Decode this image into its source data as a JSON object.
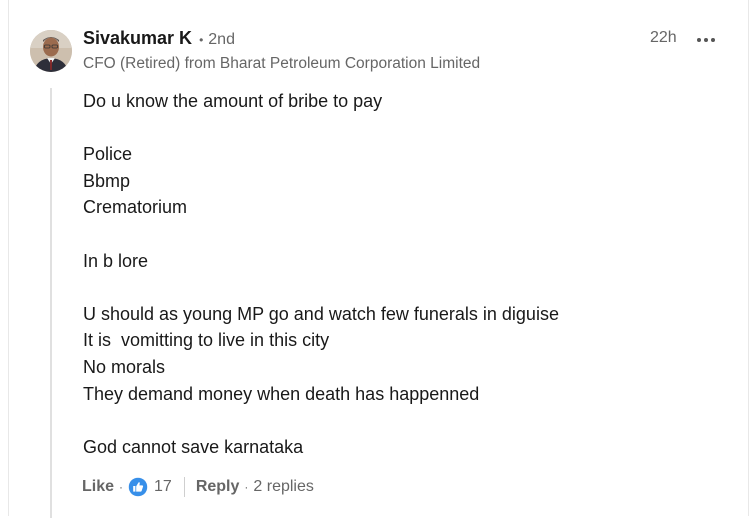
{
  "author": {
    "name": "Sivakumar K",
    "degree": "2nd",
    "headline": "CFO (Retired) from Bharat Petroleum Corporation Limited"
  },
  "timestamp": "22h",
  "comment_lines": [
    "Do u know the amount of bribe to pay",
    "",
    "Police",
    "Bbmp",
    "Crematorium",
    "",
    "In b lore",
    "",
    "U should as young MP go and watch few funerals in diguise",
    "It is  vomitting to live in this city",
    "No morals",
    "They demand money when death has happenned",
    "",
    "God cannot save karnataka"
  ],
  "actions": {
    "like_label": "Like",
    "reaction_icon": "like-thumbs-up-icon",
    "reaction_count": "17",
    "reply_label": "Reply",
    "replies_text": "2 replies"
  },
  "colors": {
    "like_blue": "#378fe9",
    "secondary_text": "#666666"
  }
}
